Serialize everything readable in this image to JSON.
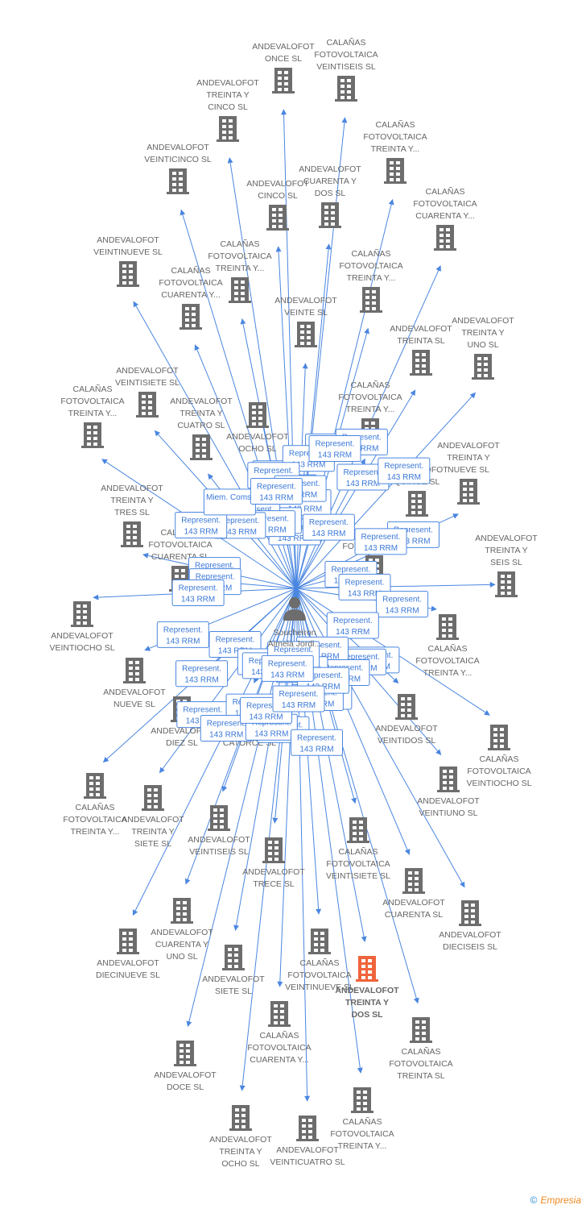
{
  "center": {
    "name_line1": "Soucheiron",
    "name_line2": "Almela Jordi...",
    "icon": "person-icon"
  },
  "colors": {
    "edge": "#4a86e0",
    "building": "#6d6d6d",
    "highlight": "#f0643c"
  },
  "badge_code": "143 RRM",
  "nodes": [
    {
      "lines": [
        "ANDEVALOFOT",
        "ONCE SL"
      ],
      "relation": "Represent."
    },
    {
      "lines": [
        "CALAÑAS",
        "FOTOVOLTAICA",
        "VEINTISEIS SL"
      ],
      "relation": "Represent."
    },
    {
      "lines": [
        "ANDEVALOFOT",
        "TREINTA Y",
        "CINCO SL"
      ],
      "relation": "Represent."
    },
    {
      "lines": [
        "CALAÑAS",
        "FOTOVOLTAICA",
        "TREINTA Y..."
      ],
      "relation": "Represent."
    },
    {
      "lines": [
        "ANDEVALOFOT",
        "VEINTICINCO SL"
      ],
      "relation": "Represent."
    },
    {
      "lines": [
        "ANDEVALOFOT",
        "CINCO SL"
      ],
      "relation": "Represent."
    },
    {
      "lines": [
        "ANDEVALOFOT",
        "CUARENTA Y",
        "DOS SL"
      ],
      "relation": "Represent."
    },
    {
      "lines": [
        "CALAÑAS",
        "FOTOVOLTAICA",
        "CUARENTA Y..."
      ],
      "relation": "Represent."
    },
    {
      "lines": [
        "ANDEVALOFOT",
        "VEINTINUEVE SL"
      ],
      "relation": "Represent."
    },
    {
      "lines": [
        "CALAÑAS",
        "FOTOVOLTAICA",
        "TREINTA Y..."
      ],
      "relation": "Represent."
    },
    {
      "lines": [
        "CALAÑAS",
        "FOTOVOLTAICA",
        "TREINTA Y..."
      ],
      "relation": "Represent."
    },
    {
      "lines": [
        "CALAÑAS",
        "FOTOVOLTAICA",
        "CUARENTA Y..."
      ],
      "relation": "Represent."
    },
    {
      "lines": [
        "ANDEVALOFOT",
        "VEINTE SL"
      ],
      "relation": "Represent."
    },
    {
      "lines": [
        "ANDEVALOFOT",
        "TREINTA SL"
      ],
      "relation": "Represent."
    },
    {
      "lines": [
        "ANDEVALOFOT",
        "TREINTA Y",
        "UNO SL"
      ],
      "relation": "Represent."
    },
    {
      "lines": [
        "ANDEVALOFOT",
        "VEINTISIETE SL"
      ],
      "relation": "Represent."
    },
    {
      "lines": [
        "CALAÑAS",
        "FOTOVOLTAICA",
        "TREINTA Y..."
      ],
      "relation": "Represent."
    },
    {
      "lines": [
        "ANDEVALOFOT",
        "TREINTA Y",
        "CUATRO SL"
      ],
      "relation": "Miem. Coms."
    },
    {
      "lines": [
        "CALAÑAS",
        "FOTOVOLTAICA",
        "TREINTA Y..."
      ],
      "relation": "Represent."
    },
    {
      "lines": [
        "ANDEVALOFOT",
        "OCHO SL"
      ],
      "relation": "Represent."
    },
    {
      "lines": [
        "ANDEVALOFOT",
        "TREINTA Y",
        "NUEVE SL"
      ],
      "relation": "Represent."
    },
    {
      "lines": [
        "ANDEVALOFOT",
        "QUINCE SL"
      ],
      "relation": "Represent."
    },
    {
      "lines": [
        "ANDEVALOFOT",
        "TREINTA Y",
        "TRES SL"
      ],
      "relation": "Represent."
    },
    {
      "lines": [
        "CALAÑAS",
        "FOTOVOLTAICA",
        "CUARENTA SL"
      ],
      "relation": "Represent."
    },
    {
      "lines": [
        "CALAÑAS",
        "FOTOVOLTAICA"
      ],
      "relation": "Represent."
    },
    {
      "lines": [
        "ANDEVALOFOT",
        "TREINTA Y",
        "SEIS SL"
      ],
      "relation": "Represent."
    },
    {
      "lines": [
        "ANDEVALOFOT",
        "VEINTIOCHO SL"
      ],
      "relation": "Represent."
    },
    {
      "lines": [
        "CALAÑAS",
        "FOTOVOLTAICA",
        "TREINTA Y..."
      ],
      "relation": "Represent."
    },
    {
      "lines": [
        "ANDEVALOFOT",
        "NUEVE SL"
      ],
      "relation": "Represent."
    },
    {
      "lines": [
        "ANDEVALOFOT",
        "DIEZ SL"
      ],
      "relation": "Represent."
    },
    {
      "lines": [
        "ANDEVALOFOT",
        "CATORCE SL"
      ],
      "relation": "Represent."
    },
    {
      "lines": [
        "ANDEVALOFOT",
        "VEINTIDOS SL"
      ],
      "relation": "Represent."
    },
    {
      "lines": [
        "CALAÑAS",
        "FOTOVOLTAICA",
        "VEINTIOCHO SL"
      ],
      "relation": "Represent."
    },
    {
      "lines": [
        "ANDEVALOFOT",
        "VEINTIUNO SL"
      ],
      "relation": "Represent."
    },
    {
      "lines": [
        "CALAÑAS",
        "FOTOVOLTAICA",
        "TREINTA Y..."
      ],
      "relation": "Represent."
    },
    {
      "lines": [
        "ANDEVALOFOT",
        "TREINTA Y",
        "SIETE SL"
      ],
      "relation": "Represent."
    },
    {
      "lines": [
        "ANDEVALOFOT",
        "VEINTISEIS SL"
      ],
      "relation": "Represent."
    },
    {
      "lines": [
        "CALAÑAS",
        "FOTOVOLTAICA",
        "VEINTISIETE SL"
      ],
      "relation": "Represent."
    },
    {
      "lines": [
        "ANDEVALOFOT",
        "TRECE SL"
      ],
      "relation": "Represent."
    },
    {
      "lines": [
        "ANDEVALOFOT",
        "CUARENTA SL"
      ],
      "relation": "Represent."
    },
    {
      "lines": [
        "ANDEVALOFOT",
        "DIECISEIS SL"
      ],
      "relation": "Represent."
    },
    {
      "lines": [
        "ANDEVALOFOT",
        "CUARENTA Y",
        "UNO SL"
      ],
      "relation": "Represent."
    },
    {
      "lines": [
        "ANDEVALOFOT",
        "DIECINUEVE SL"
      ],
      "relation": "Represent."
    },
    {
      "lines": [
        "CALAÑAS",
        "FOTOVOLTAICA",
        "VEINTINUEVE SL"
      ],
      "relation": "Represent."
    },
    {
      "lines": [
        "ANDEVALOFOT",
        "TREINTA Y",
        "DOS SL"
      ],
      "relation": "Represent.",
      "highlight": true
    },
    {
      "lines": [
        "ANDEVALOFOT",
        "SIETE SL"
      ],
      "relation": "Represent."
    },
    {
      "lines": [
        "CALAÑAS",
        "FOTOVOLTAICA",
        "CUARENTA Y..."
      ],
      "relation": "Represent."
    },
    {
      "lines": [
        "CALAÑAS",
        "FOTOVOLTAICA",
        "TREINTA SL"
      ],
      "relation": "Represent."
    },
    {
      "lines": [
        "ANDEVALOFOT",
        "DOCE SL"
      ],
      "relation": "Represent."
    },
    {
      "lines": [
        "CALAÑAS",
        "FOTOVOLTAICA",
        "TREINTA Y..."
      ],
      "relation": "Represent."
    },
    {
      "lines": [
        "ANDEVALOFOT",
        "TREINTA Y",
        "OCHO SL"
      ],
      "relation": "Represent."
    },
    {
      "lines": [
        "ANDEVALOFOT",
        "VEINTICUATRO SL"
      ],
      "relation": "Represent."
    }
  ],
  "footer": {
    "copyright": "©",
    "brand": "Empresia"
  }
}
